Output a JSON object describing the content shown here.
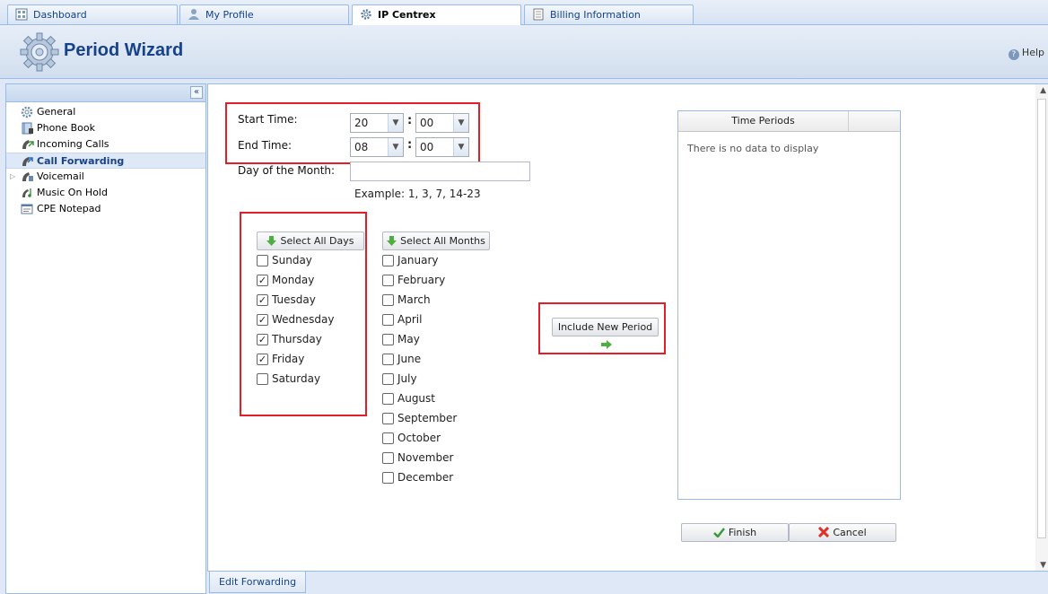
{
  "tabs": [
    {
      "label": "Dashboard",
      "icon": "dashboard-icon"
    },
    {
      "label": "My Profile",
      "icon": "profile-icon"
    },
    {
      "label": "IP Centrex",
      "icon": "gear-icon",
      "active": true
    },
    {
      "label": "Billing Information",
      "icon": "document-icon"
    }
  ],
  "header": {
    "title": "Period Wizard",
    "help_label": "Help"
  },
  "sidebar": {
    "items": [
      {
        "label": "General",
        "icon": "gear-icon"
      },
      {
        "label": "Phone Book",
        "icon": "phonebook-icon"
      },
      {
        "label": "Incoming Calls",
        "icon": "incoming-calls-icon"
      },
      {
        "label": "Call Forwarding",
        "icon": "call-forwarding-icon",
        "active": true
      },
      {
        "label": "Voicemail",
        "icon": "voicemail-icon",
        "expandable": true
      },
      {
        "label": "Music On Hold",
        "icon": "music-icon"
      },
      {
        "label": "CPE Notepad",
        "icon": "notepad-icon"
      }
    ]
  },
  "form": {
    "start_time_label": "Start Time:",
    "start_hour": "20",
    "start_minute": "00",
    "end_time_label": "End Time:",
    "end_hour": "08",
    "end_minute": "00",
    "day_of_month_label": "Day of the Month:",
    "day_of_month_value": "",
    "example_text": "Example: 1, 3, 7, 14-23",
    "select_all_days_label": "Select All Days",
    "select_all_months_label": "Select All Months",
    "include_new_period_label": "Include New Period"
  },
  "days": [
    {
      "label": "Sunday",
      "checked": false
    },
    {
      "label": "Monday",
      "checked": true
    },
    {
      "label": "Tuesday",
      "checked": true
    },
    {
      "label": "Wednesday",
      "checked": true
    },
    {
      "label": "Thursday",
      "checked": true
    },
    {
      "label": "Friday",
      "checked": true
    },
    {
      "label": "Saturday",
      "checked": false
    }
  ],
  "months": [
    {
      "label": "January",
      "checked": false
    },
    {
      "label": "February",
      "checked": false
    },
    {
      "label": "March",
      "checked": false
    },
    {
      "label": "April",
      "checked": false
    },
    {
      "label": "May",
      "checked": false
    },
    {
      "label": "June",
      "checked": false
    },
    {
      "label": "July",
      "checked": false
    },
    {
      "label": "August",
      "checked": false
    },
    {
      "label": "September",
      "checked": false
    },
    {
      "label": "October",
      "checked": false
    },
    {
      "label": "November",
      "checked": false
    },
    {
      "label": "December",
      "checked": false
    }
  ],
  "time_periods": {
    "column_header": "Time Periods",
    "empty_text": "There is no data to display"
  },
  "actions": {
    "finish_label": "Finish",
    "cancel_label": "Cancel"
  },
  "bottom": {
    "tab_label": "Edit Forwarding"
  },
  "colors": {
    "accent": "#15428b",
    "highlight_box": "#e41e26",
    "panel_border": "#99bbe8"
  }
}
